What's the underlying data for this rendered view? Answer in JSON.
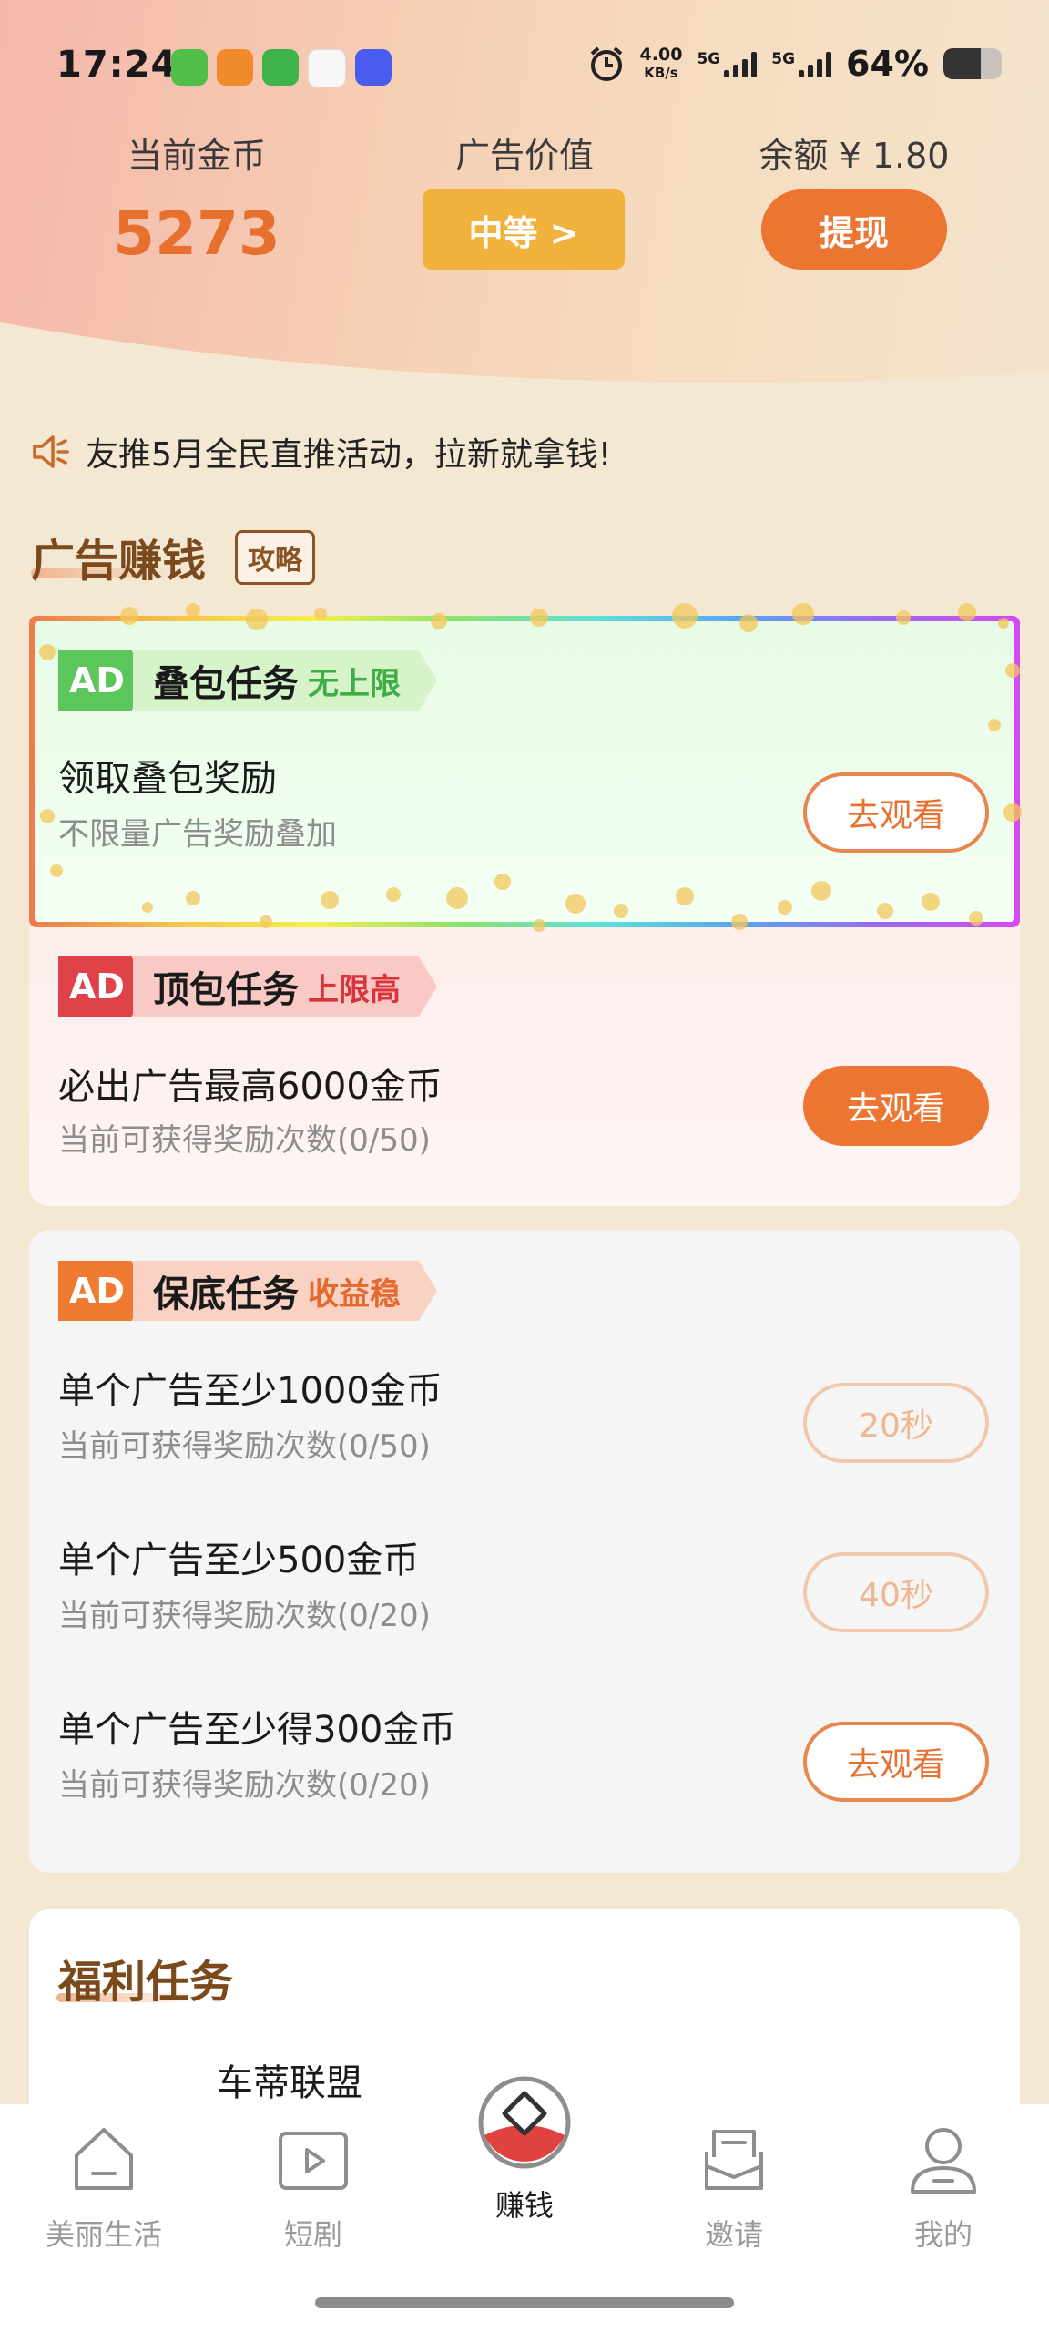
{
  "status_bar": {
    "time": "17:24",
    "net_speed_value": "4.00",
    "net_speed_unit": "KB/s",
    "signal1": "5G",
    "signal2": "5G",
    "battery": "64%",
    "app_icons": [
      "cleaner-icon",
      "apps-icon",
      "cleaner2-icon",
      "qq-icon",
      "vivo-icon"
    ]
  },
  "header": {
    "coins_label": "当前金币",
    "coins_value": "5273",
    "ad_value_label": "广告价值",
    "ad_value_button": "中等 >",
    "balance_label": "余额 ¥ 1.80",
    "withdraw_button": "提现"
  },
  "announcement": {
    "icon": "megaphone-icon",
    "text": "友推5月全民直推活动，拉新就拿钱!"
  },
  "ad_section": {
    "title": "广告赚钱",
    "tips_badge": "攻略",
    "stack_task": {
      "ad_chip": "AD",
      "name": "叠包任务",
      "tag": "无上限",
      "title": "领取叠包奖励",
      "subtitle": "不限量广告奖励叠加",
      "button": "去观看"
    },
    "top_task": {
      "ad_chip": "AD",
      "name": "顶包任务",
      "tag": "上限高",
      "title": "必出广告最高6000金币",
      "subtitle": "当前可获得奖励次数(0/50)",
      "button": "去观看"
    },
    "base_task": {
      "ad_chip": "AD",
      "name": "保底任务",
      "tag": "收益稳",
      "items": [
        {
          "title": "单个广告至少1000金币",
          "subtitle": "当前可获得奖励次数(0/50)",
          "button": "20秒"
        },
        {
          "title": "单个广告至少500金币",
          "subtitle": "当前可获得奖励次数(0/20)",
          "button": "40秒"
        },
        {
          "title": "单个广告至少得300金币",
          "subtitle": "当前可获得奖励次数(0/20)",
          "button": "去观看"
        }
      ]
    }
  },
  "welfare_section": {
    "title": "福利任务",
    "peek_text": "车蒂联盟"
  },
  "bottom_nav": {
    "items": [
      {
        "label": "美丽生活",
        "icon": "home-icon"
      },
      {
        "label": "短剧",
        "icon": "play-icon"
      },
      {
        "label": "赚钱",
        "icon": "earn-icon"
      },
      {
        "label": "邀请",
        "icon": "mail-icon"
      },
      {
        "label": "我的",
        "icon": "profile-icon"
      }
    ],
    "active_index": 2
  },
  "colors": {
    "accent": "#ec7532",
    "gold": "#f1b23d",
    "coin_text": "#e8702f",
    "green_chip": "#5cc65c",
    "red_chip": "#e0424a",
    "orange_chip": "#ef7b33"
  }
}
